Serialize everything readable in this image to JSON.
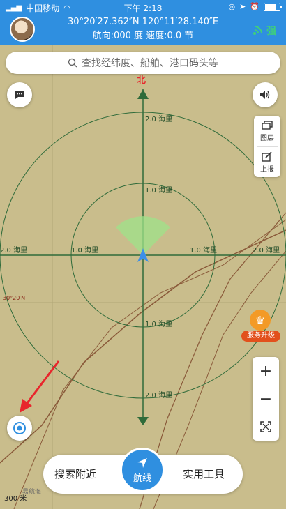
{
  "status": {
    "carrier": "中国移动",
    "time": "下午 2:18"
  },
  "header": {
    "latlon": "30°20′27.362″N 120°11′28.140″E",
    "heading_speed": "航向:000 度 速度:0.0 节",
    "signal_label": "强"
  },
  "search": {
    "placeholder": "查找经纬度、船舶、港口码头等"
  },
  "compass": {
    "north": "北"
  },
  "rings": {
    "r2": "2.0 海里",
    "r1": "1.0 海里"
  },
  "map": {
    "lat_label": "30°20′N"
  },
  "layer_panel": {
    "layers": "图层",
    "report": "上报"
  },
  "upgrade": {
    "label": "服务升级"
  },
  "zoom": {
    "plus": "+",
    "minus": "−"
  },
  "bottom": {
    "nearby": "搜索附近",
    "route": "航线",
    "tools": "实用工具"
  },
  "scale": "300 米",
  "watermark": "易航海",
  "icons": {
    "chat": "chat-icon",
    "sound": "speaker-icon",
    "locate": "locate-icon",
    "layers": "layers-icon",
    "report": "edit-icon",
    "fullscreen": "fullscreen-icon",
    "route": "navigation-arrow-icon"
  },
  "colors": {
    "brand": "#2f8fe0",
    "map": "#c9bd8c",
    "ring": "#2f6b3a",
    "arrow": "#e8262c"
  }
}
